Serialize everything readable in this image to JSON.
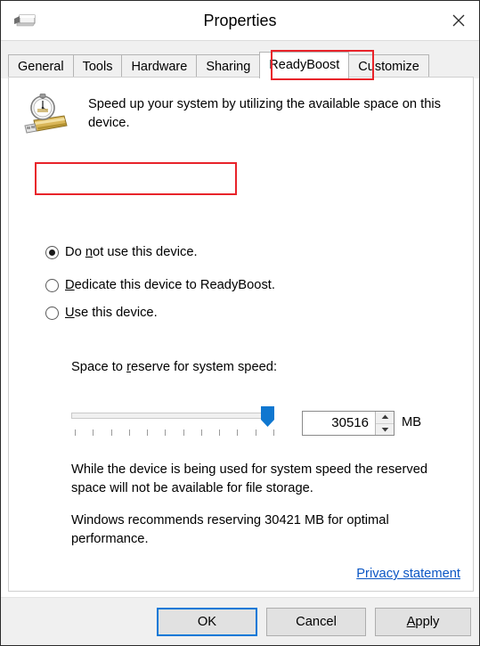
{
  "window": {
    "title": "Properties",
    "icon": "usb-drive-icon",
    "close_label": "Close"
  },
  "tabs": [
    {
      "label": "General",
      "active": false
    },
    {
      "label": "Tools",
      "active": false
    },
    {
      "label": "Hardware",
      "active": false
    },
    {
      "label": "Sharing",
      "active": false
    },
    {
      "label": "ReadyBoost",
      "active": true
    },
    {
      "label": "Customize",
      "active": false
    }
  ],
  "panel": {
    "icon": "stopwatch-usb-drive-icon",
    "description": "Speed up your system by utilizing the available space on this device.",
    "options": [
      {
        "label_pre": "Do ",
        "accel": "n",
        "label_post": "ot use this device.",
        "selected": true
      },
      {
        "label_pre": "",
        "accel": "D",
        "label_post": "edicate this device to ReadyBoost.",
        "selected": false
      },
      {
        "label_pre": "",
        "accel": "U",
        "label_post": "se this device.",
        "selected": false
      }
    ],
    "slider": {
      "label_pre": "Space to ",
      "label_accel": "r",
      "label_post": "eserve for system speed:",
      "tick_count": 12,
      "value_percent": 94,
      "thumb_color": "#0f77d0"
    },
    "spinner": {
      "value": "30516",
      "unit": "MB",
      "up_label": "Increase",
      "down_label": "Decrease"
    },
    "note_1": "While the device is being used for system speed the reserved space will not be available for file storage.",
    "note_2": "Windows recommends reserving 30421 MB for optimal performance.",
    "privacy_link": "Privacy statement"
  },
  "footer": {
    "ok": "OK",
    "cancel": "Cancel",
    "apply_pre": "",
    "apply_accel": "A",
    "apply_post": "pply"
  },
  "annotations": {
    "accent_color": "#e8232a",
    "highlighted_tab": "ReadyBoost",
    "highlighted_option": "Do not use this device."
  }
}
